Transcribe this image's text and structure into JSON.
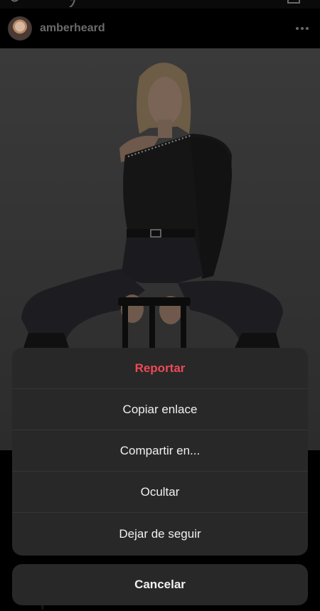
{
  "post": {
    "username": "amberheard"
  },
  "action_sheet": {
    "items": [
      {
        "label": "Reportar",
        "style": "destructive"
      },
      {
        "label": "Copiar enlace",
        "style": "default"
      },
      {
        "label": "Compartir en...",
        "style": "default"
      },
      {
        "label": "Ocultar",
        "style": "default"
      },
      {
        "label": "Dejar de seguir",
        "style": "default"
      }
    ],
    "cancel_label": "Cancelar"
  },
  "colors": {
    "destructive": "#ed4956",
    "sheet_background": "#282828",
    "text": "#f0f0f0"
  },
  "icons": {
    "more": "more-horizontal-icon"
  }
}
